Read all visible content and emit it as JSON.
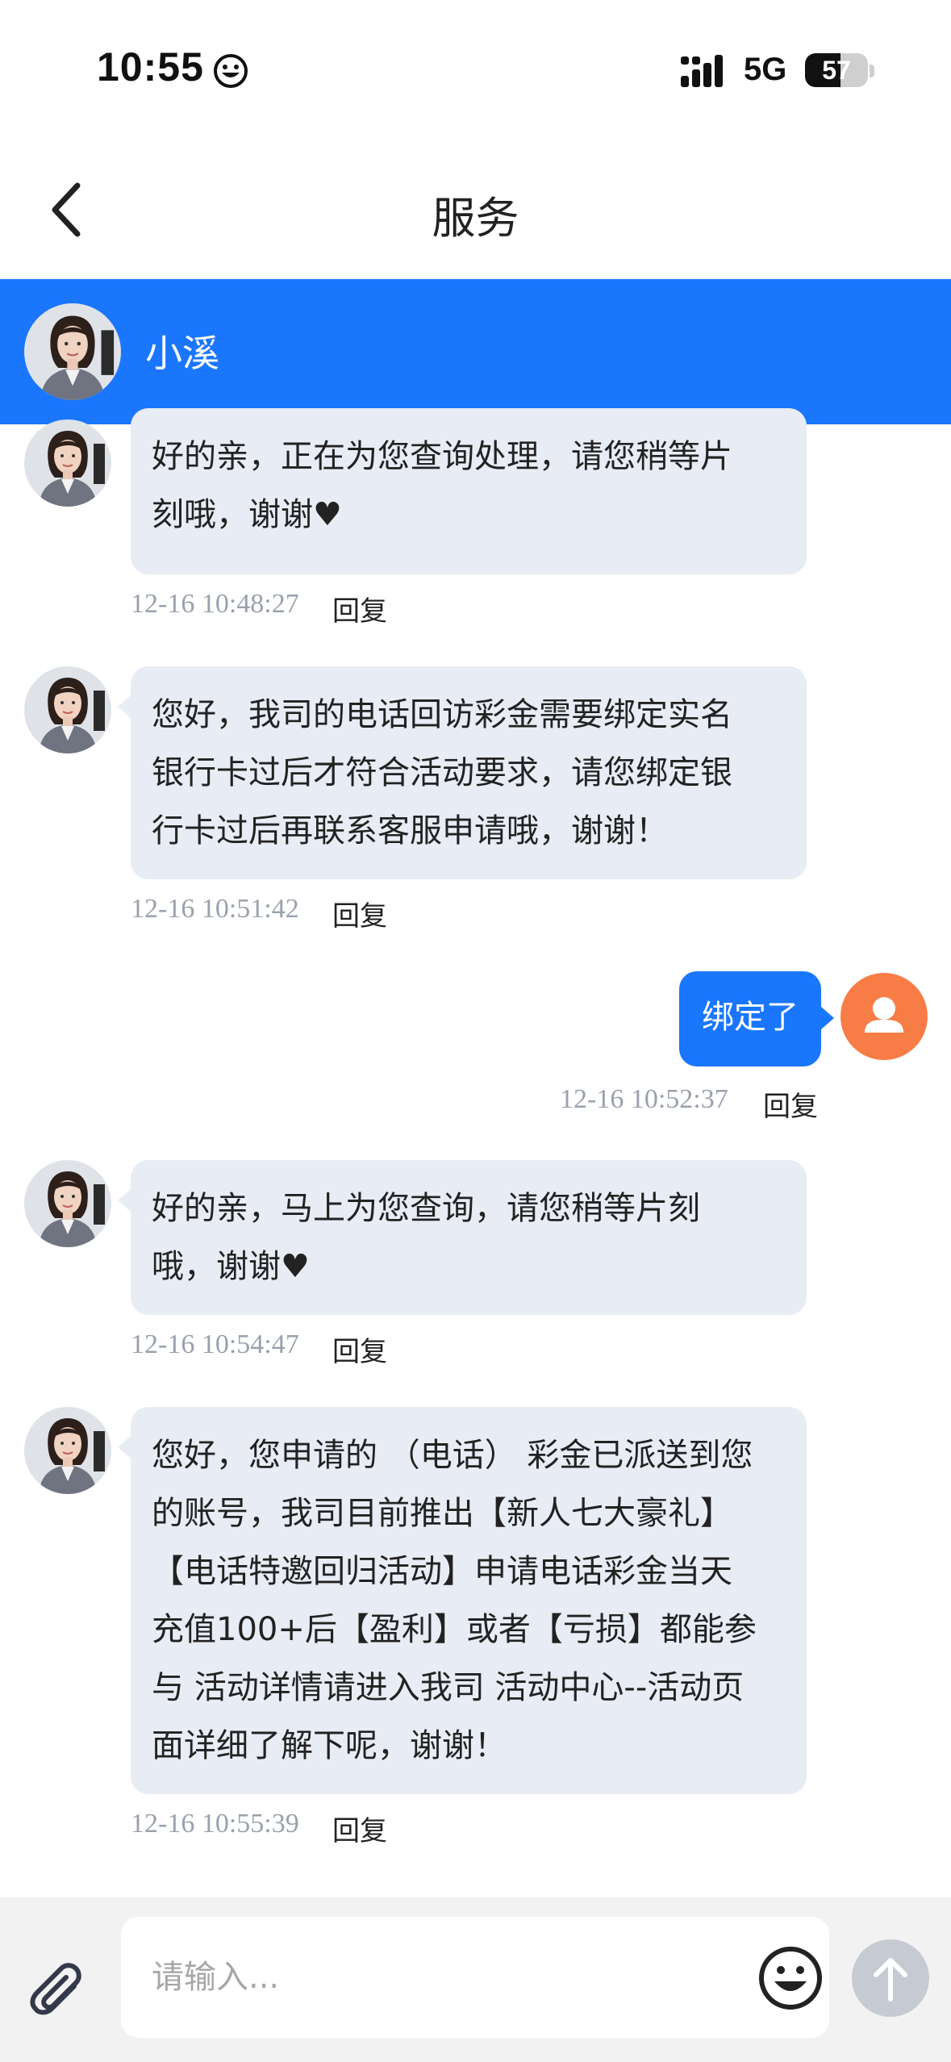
{
  "status_bar": {
    "time": "10:55",
    "network": "5G",
    "battery": "57",
    "battery_level": 0.57,
    "icons": [
      "smiley-icon",
      "signal-icon",
      "battery-icon"
    ]
  },
  "nav": {
    "title": "服务",
    "back_icon": "chevron-left-icon"
  },
  "agent": {
    "name": "小溪",
    "avatar_icon": "agent-avatar"
  },
  "messages": [
    {
      "sender": "agent",
      "text": "好的亲，正在为您查询处理，请您稍等片\n刻哦，谢谢♥",
      "time": "12-16 10:48:27",
      "reply": "回复"
    },
    {
      "sender": "agent",
      "text": "您好，我司的电话回访彩金需要绑定实名\n银行卡过后才符合活动要求，请您绑定银\n行卡过后再联系客服申请哦，谢谢！",
      "time": "12-16 10:51:42",
      "reply": "回复"
    },
    {
      "sender": "user",
      "text": "绑定了",
      "time": "12-16 10:52:37",
      "reply": "回复"
    },
    {
      "sender": "agent",
      "text": "好的亲，马上为您查询，请您稍等片刻\n哦，谢谢♥",
      "time": "12-16 10:54:47",
      "reply": "回复"
    },
    {
      "sender": "agent",
      "text": "您好，您申请的 （电话） 彩金已派送到您\n的账号，我司目前推出【新人七大豪礼】\n【电话特邀回归活动】申请电话彩金当天\n充值100+后【盈利】或者【亏损】都能参\n与 活动详情请进入我司 活动中心--活动页\n面详细了解下呢，谢谢！",
      "time": "12-16 10:55:39",
      "reply": "回复"
    }
  ],
  "input": {
    "placeholder": "请输入...",
    "value": "",
    "icons": [
      "paperclip-icon",
      "emoji-icon",
      "send-arrow-icon"
    ]
  },
  "colors": {
    "accent": "#1a76fd",
    "bubble_agent": "#e8ecf4",
    "user_avatar": "#f87c45",
    "send_disabled": "#c6cbd3"
  }
}
